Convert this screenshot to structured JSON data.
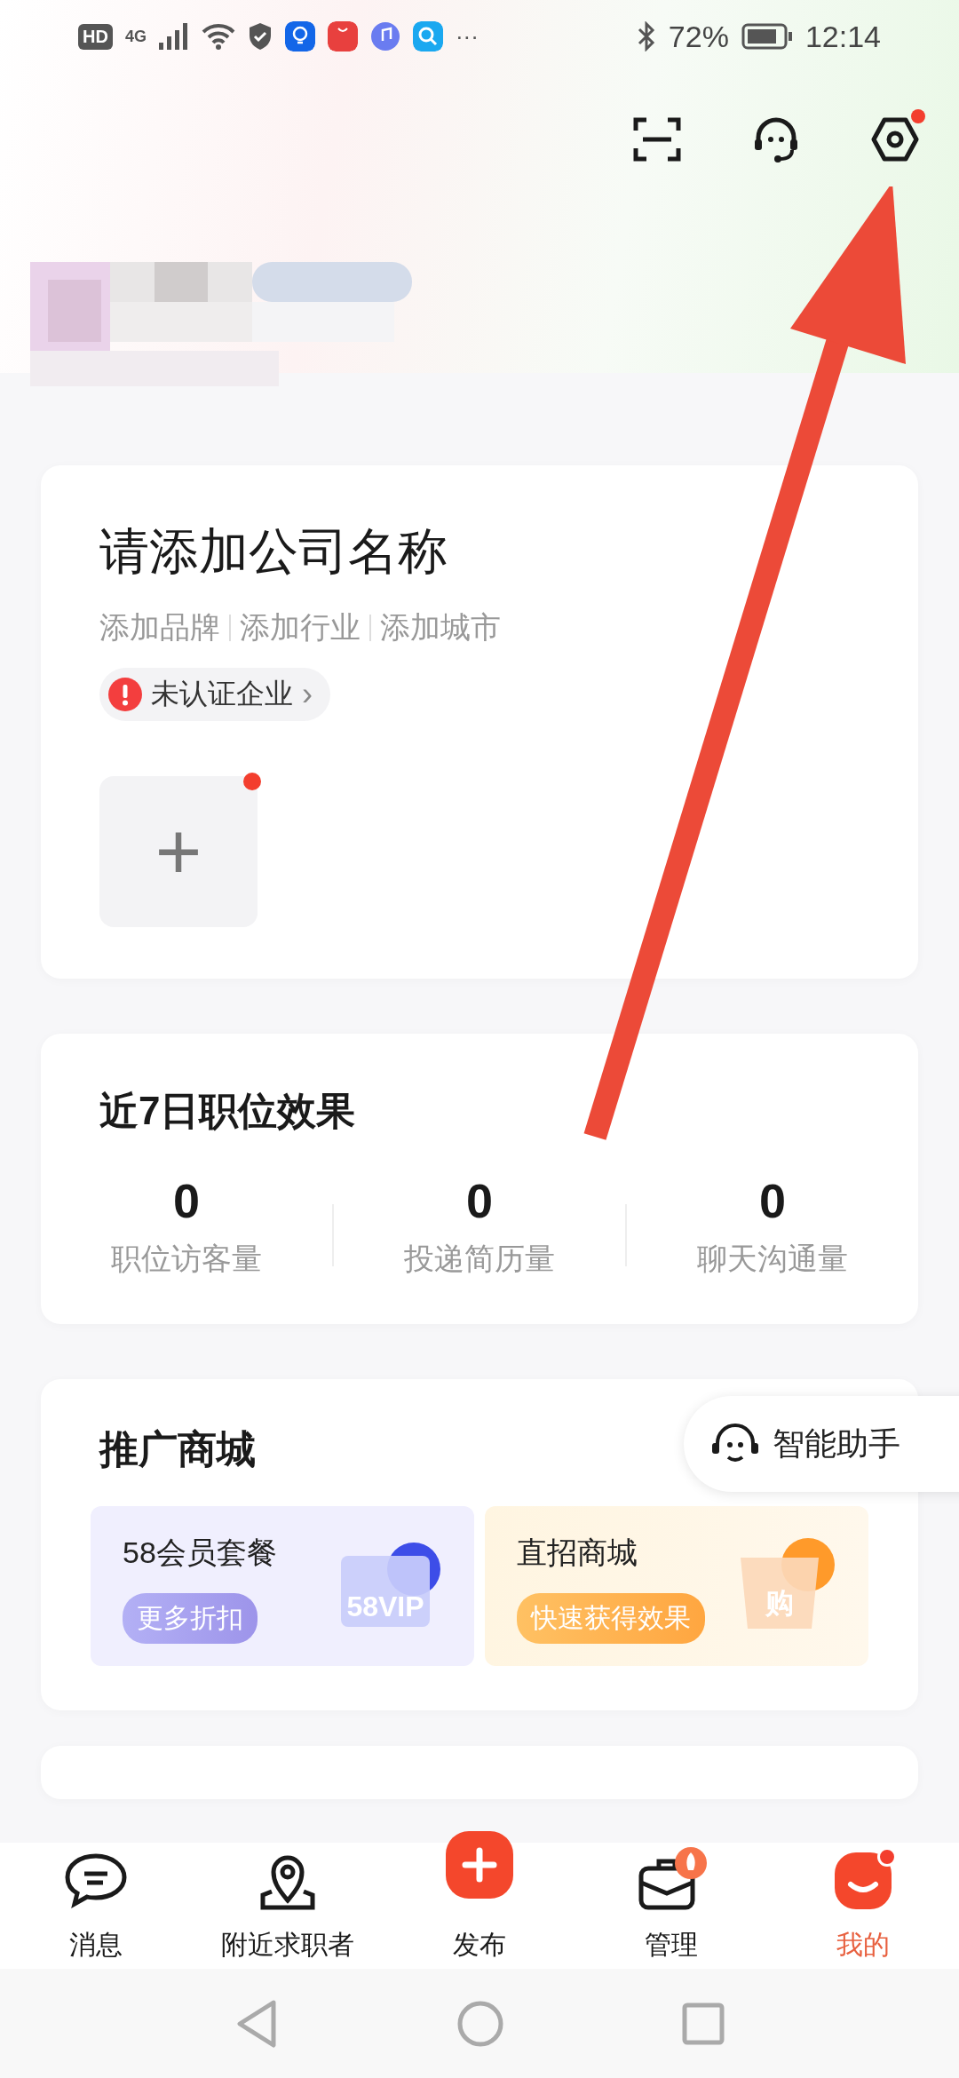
{
  "status_bar": {
    "hd": "HD",
    "network": "4G",
    "more": "···",
    "battery": "72%",
    "time": "12:14"
  },
  "header": {
    "settings_badge": true
  },
  "company_card": {
    "title": "请添加公司名称",
    "tags": [
      "添加品牌",
      "添加行业",
      "添加城市"
    ],
    "verify": {
      "label": "未认证企业",
      "chevron": "›"
    },
    "add_tile": {
      "icon": "+",
      "badge": true
    }
  },
  "stats_card": {
    "title": "近7日职位效果",
    "stats": [
      {
        "value": "0",
        "label": "职位访客量"
      },
      {
        "value": "0",
        "label": "投递简历量"
      },
      {
        "value": "0",
        "label": "聊天沟通量"
      }
    ]
  },
  "assistant": {
    "label": "智能助手"
  },
  "shop_card": {
    "title": "推广商城",
    "promos": [
      {
        "kind": "vip",
        "title": "58会员套餐",
        "button": "更多折扣",
        "art_text": "58VIP"
      },
      {
        "kind": "shop",
        "title": "直招商城",
        "button": "快速获得效果",
        "art_text": "购"
      }
    ]
  },
  "nav": [
    {
      "kind": "chat",
      "label": "消息",
      "selected": false,
      "badge": false
    },
    {
      "kind": "map",
      "label": "附近求职者",
      "selected": false,
      "badge": false
    },
    {
      "kind": "publish",
      "label": "发布",
      "selected": false,
      "badge": false
    },
    {
      "kind": "briefcase",
      "label": "管理",
      "selected": false,
      "badge": false
    },
    {
      "kind": "profile",
      "label": "我的",
      "selected": true,
      "badge": true
    }
  ]
}
